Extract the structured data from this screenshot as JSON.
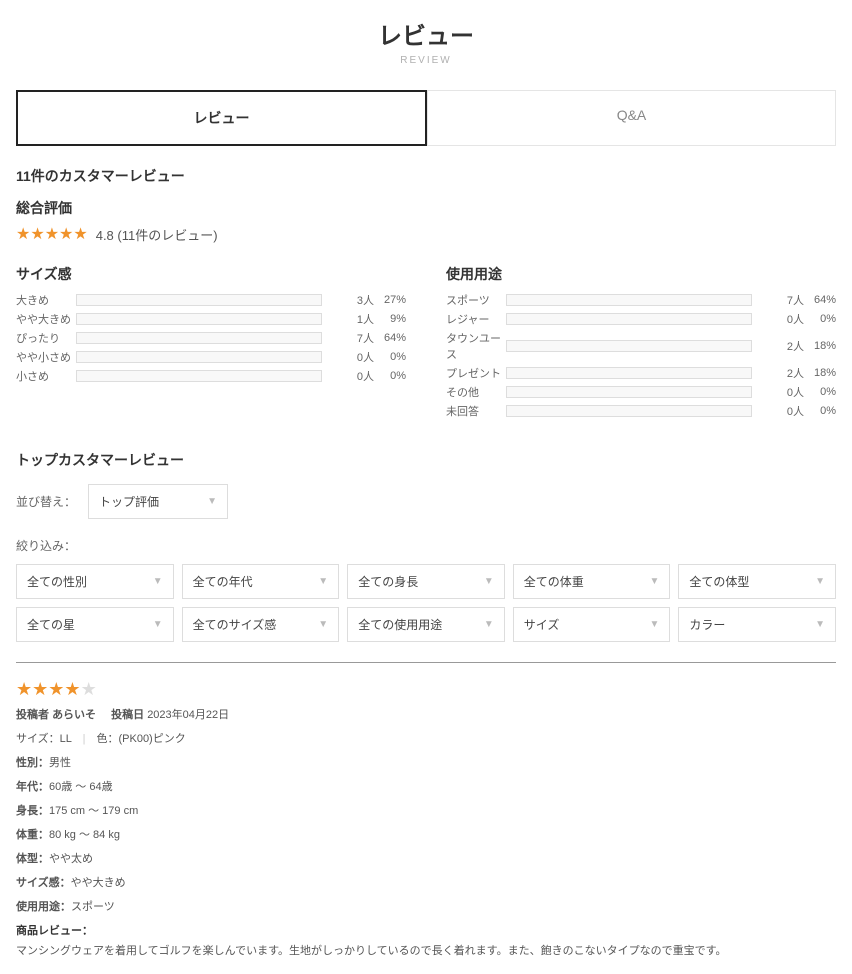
{
  "header": {
    "title": "レビュー",
    "subtitle": "REVIEW"
  },
  "tabs": {
    "review": "レビュー",
    "qa": "Q&A"
  },
  "summary": {
    "count_text": "11件のカスタマーレビュー",
    "overall_label": "総合評価",
    "rating": 4.8,
    "review_count_text": "(11件のレビュー)",
    "score_display": "4.8"
  },
  "chart_data": [
    {
      "type": "bar",
      "title": "サイズ感",
      "categories": [
        "大きめ",
        "やや大きめ",
        "ぴったり",
        "やや小さめ",
        "小さめ"
      ],
      "values": [
        27,
        9,
        64,
        0,
        0
      ],
      "counts": [
        3,
        1,
        7,
        0,
        0
      ],
      "xlabel": "",
      "ylabel": "%",
      "ylim": [
        0,
        100
      ]
    },
    {
      "type": "bar",
      "title": "使用用途",
      "categories": [
        "スポーツ",
        "レジャー",
        "タウンユース",
        "プレゼント",
        "その他",
        "未回答"
      ],
      "values": [
        64,
        0,
        18,
        18,
        0,
        0
      ],
      "counts": [
        7,
        0,
        2,
        2,
        0,
        0
      ],
      "xlabel": "",
      "ylabel": "%",
      "ylim": [
        0,
        100
      ]
    }
  ],
  "sort": {
    "section_label": "トップカスタマーレビュー",
    "label": "並び替え：",
    "selected": "トップ評価"
  },
  "filter": {
    "label": "絞り込み：",
    "options": [
      "全ての性別",
      "全ての年代",
      "全ての身長",
      "全ての体重",
      "全ての体型",
      "全ての星",
      "全てのサイズ感",
      "全ての使用用途",
      "サイズ",
      "カラー"
    ]
  },
  "review": {
    "rating": 4,
    "author_label": "投稿者",
    "author": "あらいそ",
    "date_label": "投稿日",
    "date": "2023年04月22日",
    "size_label": "サイズ：",
    "size_value": "LL",
    "color_label": "色：",
    "color_value": "(PK00)ピンク",
    "attrs": {
      "gender_label": "性別：",
      "gender_value": "男性",
      "age_label": "年代：",
      "age_value": "60歳 ～ 64歳",
      "height_label": "身長：",
      "height_value": "175 cm ～ 179 cm",
      "weight_label": "体重：",
      "weight_value": "80 kg ～ 84 kg",
      "body_label": "体型：",
      "body_value": "やや太め",
      "sizefeel_label": "サイズ感：",
      "sizefeel_value": "やや大きめ",
      "purpose_label": "使用用途：",
      "purpose_value": "スポーツ"
    },
    "body_label": "商品レビュー：",
    "body": "マンシングウェアを着用してゴルフを楽しんでいます。生地がしっかりしているので長く着れます。また、飽きのこないタイプなので重宝です。"
  },
  "unit": {
    "person": "人",
    "percent": "%"
  }
}
